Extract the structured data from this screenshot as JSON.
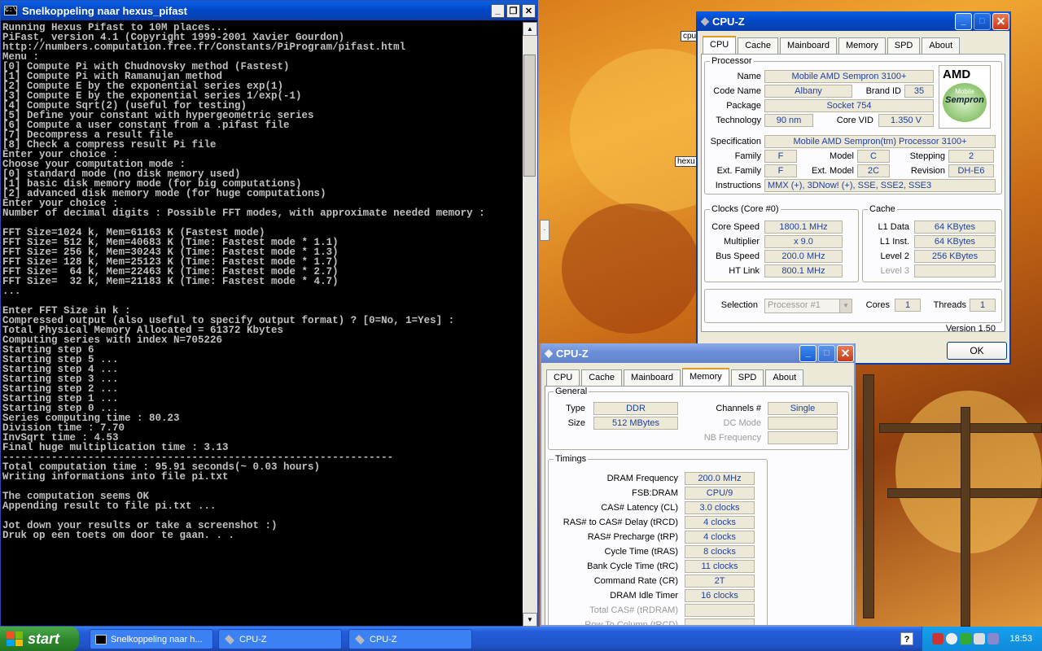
{
  "desktop": {
    "tag_cpu": "cpu",
    "tag_hexus": "hexu"
  },
  "console": {
    "title": "Snelkoppeling naar hexus_pifast",
    "lines": [
      "Running Hexus Pifast to 10M places...",
      "PiFast, version 4.1 (Copyright 1999-2001 Xavier Gourdon)",
      "http://numbers.computation.free.fr/Constants/PiProgram/pifast.html",
      "Menu :",
      "[0] Compute Pi with Chudnovsky method (Fastest)",
      "[1] Compute Pi with Ramanujan method",
      "[2] Compute E by the exponential series exp(1)",
      "[3] Compute E by the exponential series 1/exp(-1)",
      "[4] Compute Sqrt(2) (useful for testing)",
      "[5] Define your constant with hypergeometric series",
      "[6] Compute a user constant from a .pifast file",
      "[7] Decompress a result file",
      "[8] Check a compress result Pi file",
      "Enter your choice :",
      "Choose your computation mode :",
      "[0] standard mode (no disk memory used)",
      "[1] basic disk memory mode (for big computations)",
      "[2] advanced disk memory mode (for huge computations)",
      "Enter your choice :",
      "Number of decimal digits : Possible FFT modes, with approximate needed memory :",
      "",
      "FFT Size=1024 k, Mem=61163 K (Fastest mode)",
      "FFT Size= 512 k, Mem=40683 K (Time: Fastest mode * 1.1)",
      "FFT Size= 256 k, Mem=30243 K (Time: Fastest mode * 1.3)",
      "FFT Size= 128 k, Mem=25123 K (Time: Fastest mode * 1.7)",
      "FFT Size=  64 k, Mem=22463 K (Time: Fastest mode * 2.7)",
      "FFT Size=  32 k, Mem=21183 K (Time: Fastest mode * 4.7)",
      "...",
      "",
      "Enter FFT Size in k :",
      "Compressed output (also useful to specify output format) ? [0=No, 1=Yes] :",
      "Total Physical Memory Allocated = 61372 Kbytes",
      "Computing series with index N=705226",
      "Starting step 6",
      "Starting step 5 ...",
      "Starting step 4 ...",
      "Starting step 3 ...",
      "Starting step 2 ...",
      "Starting step 1 ...",
      "Starting step 0 ...",
      "Series computing time : 80.23",
      "Division time : 7.70",
      "InvSqrt time : 4.53",
      "Final huge multiplication time : 3.13",
      "----------------------------------------------------------------",
      "Total computation time : 95.91 seconds(~ 0.03 hours)",
      "Writing informations into file pi.txt",
      "",
      "The computation seems OK",
      "Appending result to file pi.txt ...",
      "",
      "Jot down your results or take a screenshot :)",
      "Druk op een toets om door te gaan. . ."
    ]
  },
  "cpuz1": {
    "title": "CPU-Z",
    "tabs": [
      "CPU",
      "Cache",
      "Mainboard",
      "Memory",
      "SPD",
      "About"
    ],
    "processor": {
      "legend": "Processor",
      "name_l": "Name",
      "name": "Mobile AMD Sempron 3100+",
      "code_l": "Code Name",
      "code": "Albany",
      "brand_l": "Brand ID",
      "brand": "35",
      "pkg_l": "Package",
      "pkg": "Socket 754",
      "tech_l": "Technology",
      "tech": "90 nm",
      "vid_l": "Core VID",
      "vid": "1.350 V",
      "spec_l": "Specification",
      "spec": "Mobile AMD Sempron(tm) Processor 3100+",
      "fam_l": "Family",
      "fam": "F",
      "model_l": "Model",
      "model": "C",
      "step_l": "Stepping",
      "step": "2",
      "efam_l": "Ext. Family",
      "efam": "F",
      "emodel_l": "Ext. Model",
      "emodel": "2C",
      "rev_l": "Revision",
      "rev": "DH-E6",
      "inst_l": "Instructions",
      "inst": "MMX (+), 3DNow! (+), SSE, SSE2, SSE3"
    },
    "logo": {
      "brand": "AMD",
      "sub": "Mobile",
      "name": "Sempron"
    },
    "clocks": {
      "legend": "Clocks (Core #0)",
      "cs_l": "Core Speed",
      "cs": "1800.1 MHz",
      "mul_l": "Multiplier",
      "mul": "x 9.0",
      "bus_l": "Bus Speed",
      "bus": "200.0 MHz",
      "ht_l": "HT Link",
      "ht": "800.1 MHz"
    },
    "cache": {
      "legend": "Cache",
      "l1d_l": "L1 Data",
      "l1d": "64 KBytes",
      "l1i_l": "L1 Inst.",
      "l1i": "64 KBytes",
      "l2_l": "Level 2",
      "l2": "256 KBytes",
      "l3_l": "Level 3"
    },
    "sel": {
      "sel_l": "Selection",
      "sel": "Processor #1",
      "cores_l": "Cores",
      "cores": "1",
      "thr_l": "Threads",
      "thr": "1"
    },
    "version": "Version 1.50",
    "ok": "OK"
  },
  "cpuz2": {
    "title": "CPU-Z",
    "tabs": [
      "CPU",
      "Cache",
      "Mainboard",
      "Memory",
      "SPD",
      "About"
    ],
    "general": {
      "legend": "General",
      "type_l": "Type",
      "type": "DDR",
      "size_l": "Size",
      "size": "512 MBytes",
      "ch_l": "Channels #",
      "ch": "Single",
      "dc_l": "DC Mode",
      "nb_l": "NB Frequency"
    },
    "timings": {
      "legend": "Timings",
      "rows": [
        [
          "DRAM Frequency",
          "200.0 MHz"
        ],
        [
          "FSB:DRAM",
          "CPU/9"
        ],
        [
          "CAS# Latency (CL)",
          "3.0 clocks"
        ],
        [
          "RAS# to CAS# Delay (tRCD)",
          "4 clocks"
        ],
        [
          "RAS# Precharge (tRP)",
          "4 clocks"
        ],
        [
          "Cycle Time (tRAS)",
          "8 clocks"
        ],
        [
          "Bank Cycle Time (tRC)",
          "11 clocks"
        ],
        [
          "Command Rate (CR)",
          "2T"
        ],
        [
          "DRAM Idle Timer",
          "16 clocks"
        ],
        [
          "Total CAS# (tRDRAM)",
          ""
        ],
        [
          "Row To Column (tRCD)",
          ""
        ]
      ]
    }
  },
  "taskbar": {
    "start": "start",
    "tasks": [
      "Snelkoppeling naar h...",
      "CPU-Z",
      "CPU-Z"
    ],
    "clock": "18:53",
    "help": "?"
  }
}
